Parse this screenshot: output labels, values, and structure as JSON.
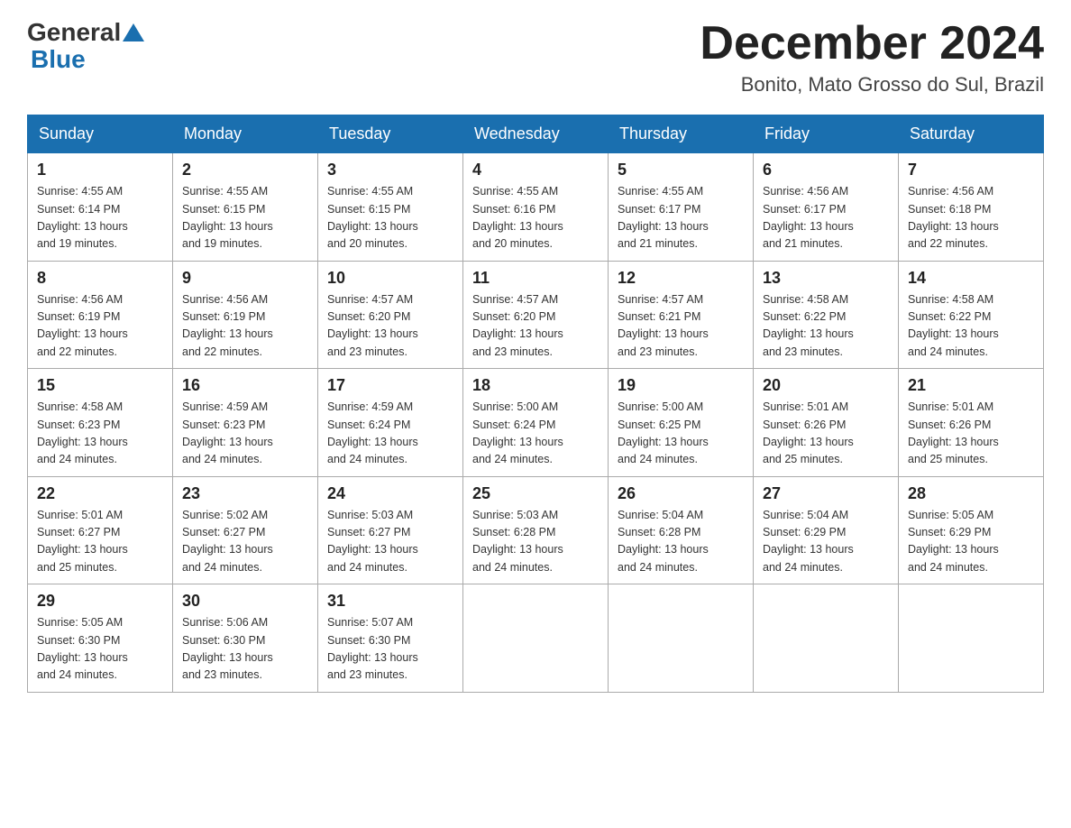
{
  "header": {
    "logo_general": "General",
    "logo_blue": "Blue",
    "month_title": "December 2024",
    "location": "Bonito, Mato Grosso do Sul, Brazil"
  },
  "weekdays": [
    "Sunday",
    "Monday",
    "Tuesday",
    "Wednesday",
    "Thursday",
    "Friday",
    "Saturday"
  ],
  "weeks": [
    [
      {
        "day": "1",
        "sunrise": "4:55 AM",
        "sunset": "6:14 PM",
        "daylight": "13 hours and 19 minutes."
      },
      {
        "day": "2",
        "sunrise": "4:55 AM",
        "sunset": "6:15 PM",
        "daylight": "13 hours and 19 minutes."
      },
      {
        "day": "3",
        "sunrise": "4:55 AM",
        "sunset": "6:15 PM",
        "daylight": "13 hours and 20 minutes."
      },
      {
        "day": "4",
        "sunrise": "4:55 AM",
        "sunset": "6:16 PM",
        "daylight": "13 hours and 20 minutes."
      },
      {
        "day": "5",
        "sunrise": "4:55 AM",
        "sunset": "6:17 PM",
        "daylight": "13 hours and 21 minutes."
      },
      {
        "day": "6",
        "sunrise": "4:56 AM",
        "sunset": "6:17 PM",
        "daylight": "13 hours and 21 minutes."
      },
      {
        "day": "7",
        "sunrise": "4:56 AM",
        "sunset": "6:18 PM",
        "daylight": "13 hours and 22 minutes."
      }
    ],
    [
      {
        "day": "8",
        "sunrise": "4:56 AM",
        "sunset": "6:19 PM",
        "daylight": "13 hours and 22 minutes."
      },
      {
        "day": "9",
        "sunrise": "4:56 AM",
        "sunset": "6:19 PM",
        "daylight": "13 hours and 22 minutes."
      },
      {
        "day": "10",
        "sunrise": "4:57 AM",
        "sunset": "6:20 PM",
        "daylight": "13 hours and 23 minutes."
      },
      {
        "day": "11",
        "sunrise": "4:57 AM",
        "sunset": "6:20 PM",
        "daylight": "13 hours and 23 minutes."
      },
      {
        "day": "12",
        "sunrise": "4:57 AM",
        "sunset": "6:21 PM",
        "daylight": "13 hours and 23 minutes."
      },
      {
        "day": "13",
        "sunrise": "4:58 AM",
        "sunset": "6:22 PM",
        "daylight": "13 hours and 23 minutes."
      },
      {
        "day": "14",
        "sunrise": "4:58 AM",
        "sunset": "6:22 PM",
        "daylight": "13 hours and 24 minutes."
      }
    ],
    [
      {
        "day": "15",
        "sunrise": "4:58 AM",
        "sunset": "6:23 PM",
        "daylight": "13 hours and 24 minutes."
      },
      {
        "day": "16",
        "sunrise": "4:59 AM",
        "sunset": "6:23 PM",
        "daylight": "13 hours and 24 minutes."
      },
      {
        "day": "17",
        "sunrise": "4:59 AM",
        "sunset": "6:24 PM",
        "daylight": "13 hours and 24 minutes."
      },
      {
        "day": "18",
        "sunrise": "5:00 AM",
        "sunset": "6:24 PM",
        "daylight": "13 hours and 24 minutes."
      },
      {
        "day": "19",
        "sunrise": "5:00 AM",
        "sunset": "6:25 PM",
        "daylight": "13 hours and 24 minutes."
      },
      {
        "day": "20",
        "sunrise": "5:01 AM",
        "sunset": "6:26 PM",
        "daylight": "13 hours and 25 minutes."
      },
      {
        "day": "21",
        "sunrise": "5:01 AM",
        "sunset": "6:26 PM",
        "daylight": "13 hours and 25 minutes."
      }
    ],
    [
      {
        "day": "22",
        "sunrise": "5:01 AM",
        "sunset": "6:27 PM",
        "daylight": "13 hours and 25 minutes."
      },
      {
        "day": "23",
        "sunrise": "5:02 AM",
        "sunset": "6:27 PM",
        "daylight": "13 hours and 24 minutes."
      },
      {
        "day": "24",
        "sunrise": "5:03 AM",
        "sunset": "6:27 PM",
        "daylight": "13 hours and 24 minutes."
      },
      {
        "day": "25",
        "sunrise": "5:03 AM",
        "sunset": "6:28 PM",
        "daylight": "13 hours and 24 minutes."
      },
      {
        "day": "26",
        "sunrise": "5:04 AM",
        "sunset": "6:28 PM",
        "daylight": "13 hours and 24 minutes."
      },
      {
        "day": "27",
        "sunrise": "5:04 AM",
        "sunset": "6:29 PM",
        "daylight": "13 hours and 24 minutes."
      },
      {
        "day": "28",
        "sunrise": "5:05 AM",
        "sunset": "6:29 PM",
        "daylight": "13 hours and 24 minutes."
      }
    ],
    [
      {
        "day": "29",
        "sunrise": "5:05 AM",
        "sunset": "6:30 PM",
        "daylight": "13 hours and 24 minutes."
      },
      {
        "day": "30",
        "sunrise": "5:06 AM",
        "sunset": "6:30 PM",
        "daylight": "13 hours and 23 minutes."
      },
      {
        "day": "31",
        "sunrise": "5:07 AM",
        "sunset": "6:30 PM",
        "daylight": "13 hours and 23 minutes."
      },
      null,
      null,
      null,
      null
    ]
  ],
  "labels": {
    "sunrise": "Sunrise:",
    "sunset": "Sunset:",
    "daylight": "Daylight:"
  }
}
